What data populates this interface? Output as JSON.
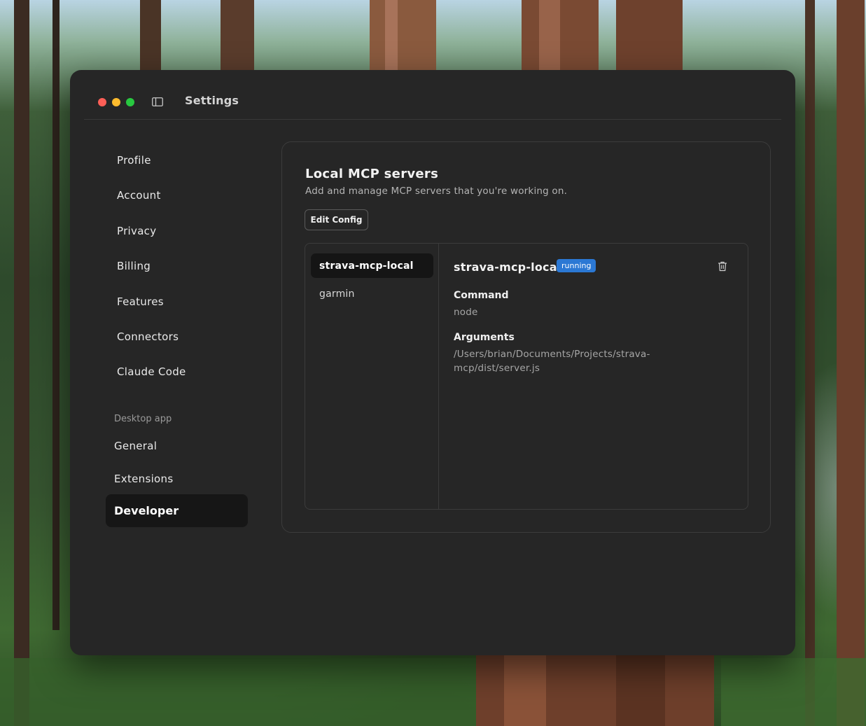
{
  "window": {
    "title": "Settings"
  },
  "sidebar": {
    "items": [
      {
        "label": "Profile"
      },
      {
        "label": "Account"
      },
      {
        "label": "Privacy"
      },
      {
        "label": "Billing"
      },
      {
        "label": "Features"
      },
      {
        "label": "Connectors"
      },
      {
        "label": "Claude Code"
      }
    ],
    "section_title": "Desktop app",
    "desktop_items": [
      {
        "label": "General"
      },
      {
        "label": "Extensions"
      },
      {
        "label": "Developer",
        "active": true
      }
    ]
  },
  "main": {
    "title": "Local MCP servers",
    "subtitle": "Add and manage MCP servers that you're working on.",
    "edit_config_label": "Edit Config",
    "servers": [
      {
        "name": "strava-mcp-local",
        "selected": true
      },
      {
        "name": "garmin",
        "selected": false
      }
    ],
    "detail": {
      "name": "strava-mcp-local",
      "status": "running",
      "command_label": "Command",
      "command_value": "node",
      "arguments_label": "Arguments",
      "arguments_line1": "/Users/brian/Documents/Projects/strava-",
      "arguments_line2": "mcp/dist/server.js"
    }
  },
  "icons": {
    "window_controls": [
      "close-icon",
      "minimize-icon",
      "zoom-icon"
    ],
    "sidebar_toggle": "sidebar-toggle-icon",
    "delete": "trash-icon"
  },
  "colors": {
    "window_bg": "#262626",
    "active_item_bg": "#161616",
    "badge_bg": "#2b78d4",
    "close": "#fe5f57",
    "minimize": "#febc2e",
    "zoom": "#28c840"
  }
}
